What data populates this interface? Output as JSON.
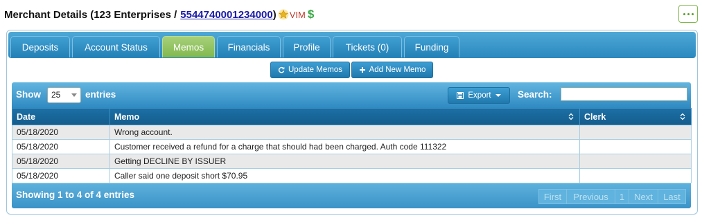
{
  "header": {
    "title_prefix": "Merchant Details (123 Enterprises /",
    "merchant_id": "5544740001234000",
    "title_suffix": ")",
    "vim_label": "VIM",
    "dollar_glyph": "$"
  },
  "tabs": [
    {
      "label": "Deposits"
    },
    {
      "label": "Account Status"
    },
    {
      "label": "Memos",
      "active": true
    },
    {
      "label": "Financials"
    },
    {
      "label": "Profile"
    },
    {
      "label": "Tickets (0)"
    },
    {
      "label": "Funding"
    }
  ],
  "actions": {
    "update_label": "Update Memos",
    "add_label": "Add New Memo"
  },
  "table_controls": {
    "show_label": "Show",
    "page_length": "25",
    "entries_label": "entries",
    "export_label": "Export",
    "search_label": "Search:",
    "search_value": ""
  },
  "table": {
    "columns": [
      "Date",
      "Memo",
      "Clerk"
    ],
    "rows": [
      {
        "date": "05/18/2020",
        "memo": "Wrong account.",
        "clerk": ""
      },
      {
        "date": "05/18/2020",
        "memo": "Customer received a refund for a charge that should had been charged. Auth code 111322",
        "clerk": ""
      },
      {
        "date": "05/18/2020",
        "memo": "Getting DECLINE BY ISSUER",
        "clerk": ""
      },
      {
        "date": "05/18/2020",
        "memo": "Caller said one deposit short $70.95",
        "clerk": ""
      }
    ]
  },
  "footer": {
    "info": "Showing 1 to 4 of 4 entries",
    "pager": {
      "first": "First",
      "previous": "Previous",
      "page": "1",
      "next": "Next",
      "last": "Last"
    }
  },
  "colors": {
    "brand_blue": "#2b89bf",
    "active_tab_green": "#82b84e",
    "link_blue": "#1a1aa6",
    "vim_red": "#c0392b",
    "dollar_green": "#3aa845"
  },
  "icons": [
    "star-icon",
    "dollar-icon",
    "more-icon",
    "refresh-icon",
    "plus-icon",
    "export-icon",
    "sort-icon"
  ]
}
